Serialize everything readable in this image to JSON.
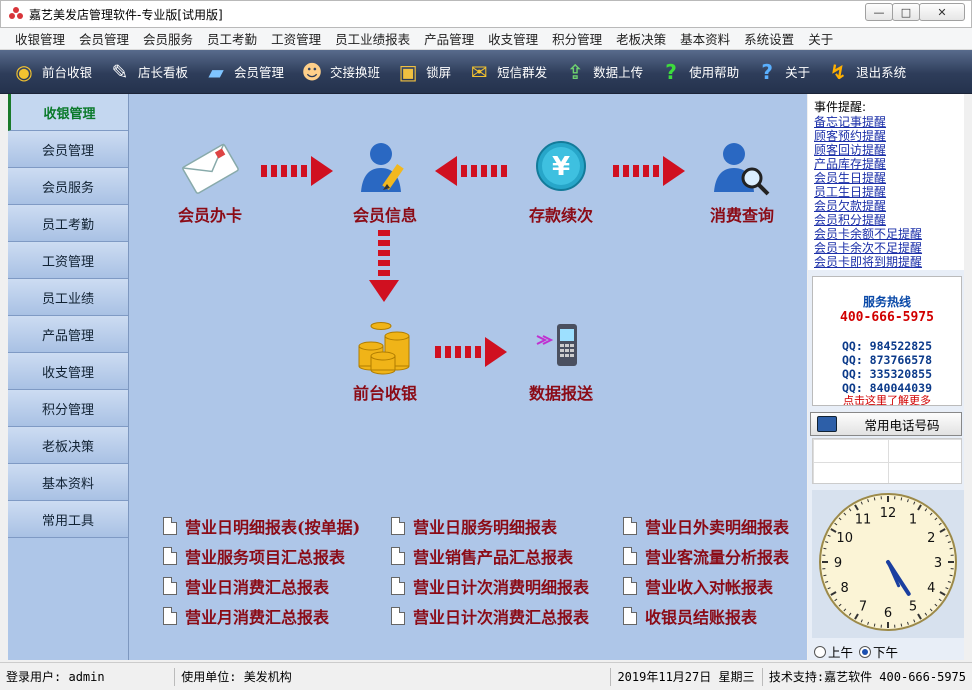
{
  "window": {
    "title": "嘉艺美发店管理软件-专业版[试用版]",
    "min": "—",
    "max": "□",
    "close": "✕"
  },
  "menu": [
    "收银管理",
    "会员管理",
    "会员服务",
    "员工考勤",
    "工资管理",
    "员工业绩报表",
    "产品管理",
    "收支管理",
    "积分管理",
    "老板决策",
    "基本资料",
    "系统设置",
    "关于"
  ],
  "toolbar": [
    {
      "label": "前台收银",
      "icon": "coins-icon"
    },
    {
      "label": "店长看板",
      "icon": "pen-icon"
    },
    {
      "label": "会员管理",
      "icon": "card-icon"
    },
    {
      "label": "交接换班",
      "icon": "users-icon"
    },
    {
      "label": "锁屏",
      "icon": "lock-icon"
    },
    {
      "label": "短信群发",
      "icon": "sms-icon"
    },
    {
      "label": "数据上传",
      "icon": "upload-icon"
    },
    {
      "label": "使用帮助",
      "icon": "help-icon"
    },
    {
      "label": "关于",
      "icon": "about-icon"
    },
    {
      "label": "退出系统",
      "icon": "exit-icon"
    }
  ],
  "sidebar": [
    "收银管理",
    "会员管理",
    "会员服务",
    "员工考勤",
    "工资管理",
    "员工业绩",
    "产品管理",
    "收支管理",
    "积分管理",
    "老板决策",
    "基本资料",
    "常用工具"
  ],
  "flow": {
    "card": "会员办卡",
    "info": "会员信息",
    "deposit": "存款续次",
    "deposit_symbol": "¥",
    "query": "消费查询",
    "cashier": "前台收银",
    "send": "数据报送"
  },
  "reports": [
    "营业日明细报表(按单据)",
    "营业日服务明细报表",
    "营业日外卖明细报表",
    "营业服务项目汇总报表",
    "营业销售产品汇总报表",
    "营业客流量分析报表",
    "营业日消费汇总报表",
    "营业日计次消费明细报表",
    "营业收入对帐报表",
    "营业月消费汇总报表",
    "营业日计次消费汇总报表",
    "收银员结账报表"
  ],
  "events": {
    "title": "事件提醒:",
    "items": [
      "备忘记事提醒",
      "顾客预约提醒",
      "顾客回访提醒",
      "产品库存提醒",
      "会员生日提醒",
      "员工生日提醒",
      "会员欠款提醒",
      "会员积分提醒",
      "会员卡余额不足提醒",
      "会员卡余次不足提醒",
      "会员卡即将到期提醒"
    ]
  },
  "hotline": {
    "title": "服务热线",
    "phone": "400-666-5975",
    "qq": [
      "QQ: 984522825",
      "QQ: 873766578",
      "QQ: 335320855",
      "QQ: 840044039"
    ],
    "more": "点击这里了解更多"
  },
  "phone_button": "常用电话号码",
  "clock": {
    "numbers": [
      "12",
      "1",
      "2",
      "3",
      "4",
      "5",
      "6",
      "7",
      "8",
      "9",
      "10",
      "11"
    ],
    "hour": 4.9,
    "minute": 26
  },
  "ampm": {
    "am": "上午",
    "pm": "下午",
    "selected": "pm"
  },
  "status": {
    "user_label": "登录用户:",
    "user": "admin",
    "unit_label": "使用单位:",
    "unit": "美发机构",
    "date": "2019年11月27日",
    "weekday": "星期三",
    "support_label": "技术支持:",
    "support": "嘉艺软件 400-666-5975"
  }
}
